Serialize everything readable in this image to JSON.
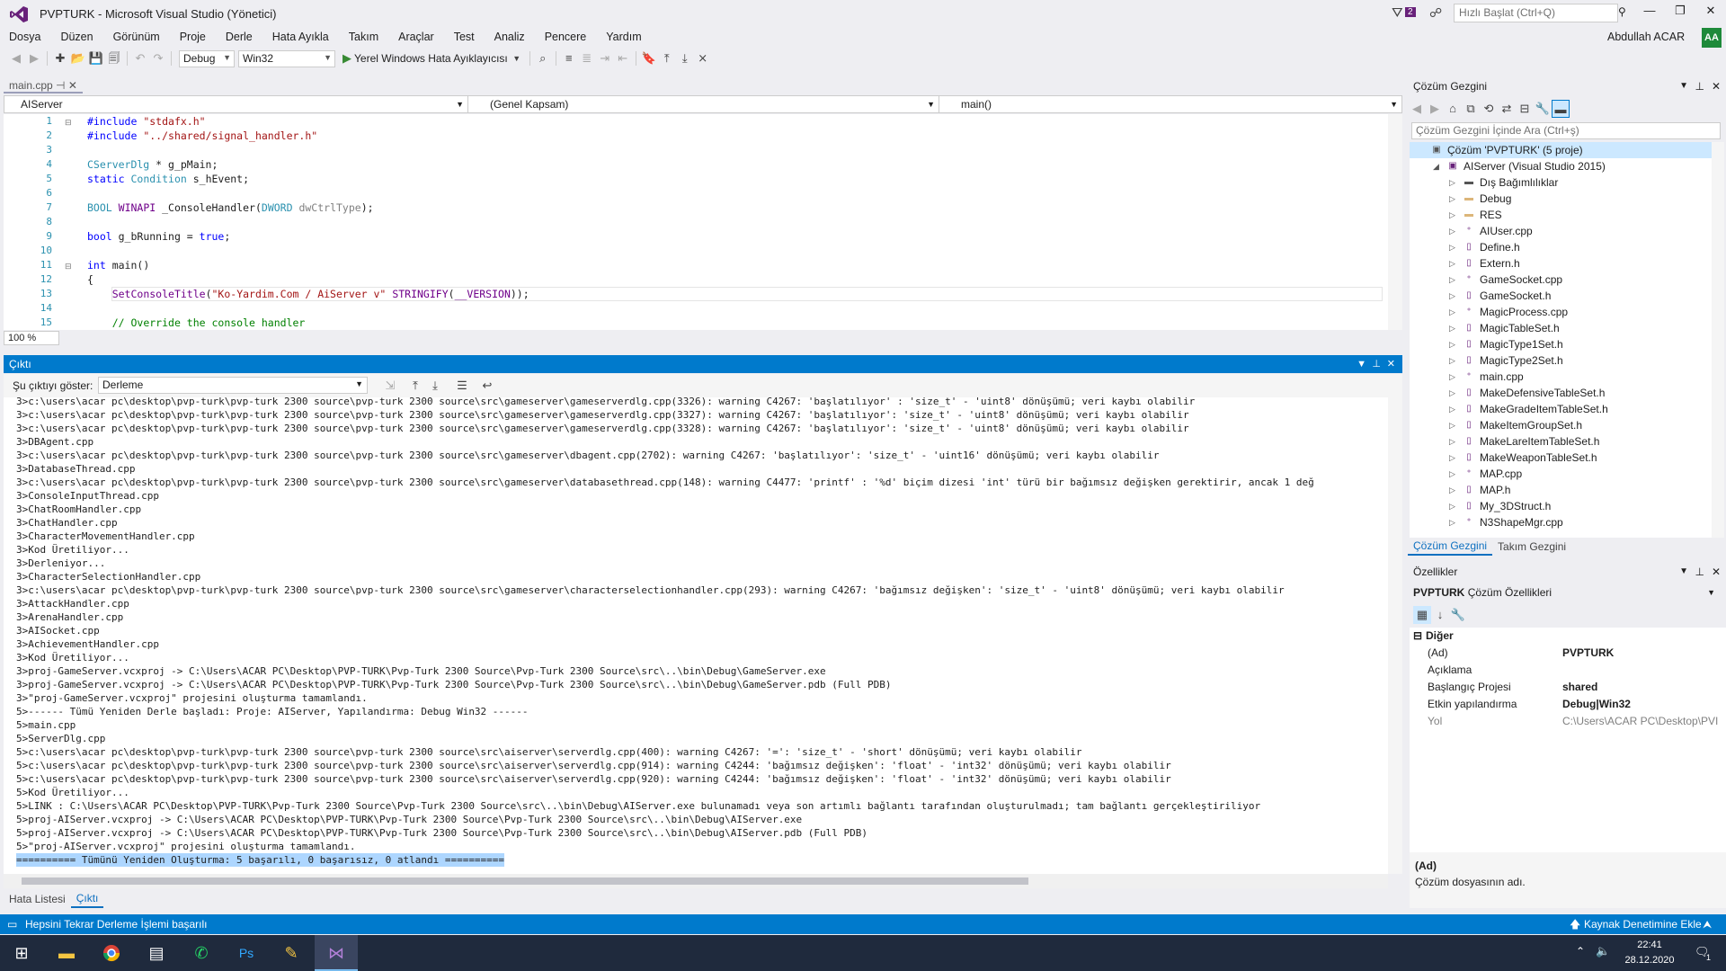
{
  "window": {
    "title": "PVPTURK - Microsoft Visual Studio (Yönetici)",
    "notifications": "2",
    "quick_launch_placeholder": "Hızlı Başlat (Ctrl+Q)",
    "user": "Abdullah ACAR",
    "user_initials": "AA"
  },
  "menu": [
    "Dosya",
    "Düzen",
    "Görünüm",
    "Proje",
    "Derle",
    "Hata Ayıkla",
    "Takım",
    "Araçlar",
    "Test",
    "Analiz",
    "Pencere",
    "Yardım"
  ],
  "toolbar": {
    "configuration": "Debug",
    "platform": "Win32",
    "run_label": "Yerel Windows Hata Ayıklayıcısı"
  },
  "editor": {
    "tab": "main.cpp",
    "nav_project": "AIServer",
    "nav_scope": "(Genel Kapsam)",
    "nav_member": "main()",
    "zoom": "100 %",
    "line_numbers": [
      "1",
      "2",
      "3",
      "4",
      "5",
      "6",
      "7",
      "8",
      "9",
      "10",
      "11",
      "12",
      "13",
      "14",
      "15"
    ]
  },
  "output": {
    "title": "Çıktı",
    "show_label": "Şu çıktıyı göster:",
    "source": "Derleme",
    "lines": [
      "3>c:\\users\\acar pc\\desktop\\pvp-turk\\pvp-turk 2300 source\\pvp-turk 2300 source\\src\\gameserver\\gameserverdlg.cpp(3326): warning C4267: 'başlatılıyor' : 'size_t' - 'uint8' dönüşümü; veri kaybı olabilir",
      "3>c:\\users\\acar pc\\desktop\\pvp-turk\\pvp-turk 2300 source\\pvp-turk 2300 source\\src\\gameserver\\gameserverdlg.cpp(3327): warning C4267: 'başlatılıyor': 'size_t' - 'uint8' dönüşümü; veri kaybı olabilir",
      "3>c:\\users\\acar pc\\desktop\\pvp-turk\\pvp-turk 2300 source\\pvp-turk 2300 source\\src\\gameserver\\gameserverdlg.cpp(3328): warning C4267: 'başlatılıyor': 'size_t' - 'uint8' dönüşümü; veri kaybı olabilir",
      "3>DBAgent.cpp",
      "3>c:\\users\\acar pc\\desktop\\pvp-turk\\pvp-turk 2300 source\\pvp-turk 2300 source\\src\\gameserver\\dbagent.cpp(2702): warning C4267: 'başlatılıyor': 'size_t' - 'uint16' dönüşümü; veri kaybı olabilir",
      "3>DatabaseThread.cpp",
      "3>c:\\users\\acar pc\\desktop\\pvp-turk\\pvp-turk 2300 source\\pvp-turk 2300 source\\src\\gameserver\\databasethread.cpp(148): warning C4477: 'printf' : '%d' biçim dizesi 'int' türü bir bağımsız değişken gerektirir, ancak 1 değ",
      "3>ConsoleInputThread.cpp",
      "3>ChatRoomHandler.cpp",
      "3>ChatHandler.cpp",
      "3>CharacterMovementHandler.cpp",
      "3>Kod Üretiliyor...",
      "3>Derleniyor...",
      "3>CharacterSelectionHandler.cpp",
      "3>c:\\users\\acar pc\\desktop\\pvp-turk\\pvp-turk 2300 source\\pvp-turk 2300 source\\src\\gameserver\\characterselectionhandler.cpp(293): warning C4267: 'bağımsız değişken': 'size_t' - 'uint8' dönüşümü; veri kaybı olabilir",
      "3>AttackHandler.cpp",
      "3>ArenaHandler.cpp",
      "3>AISocket.cpp",
      "3>AchievementHandler.cpp",
      "3>Kod Üretiliyor...",
      "3>proj-GameServer.vcxproj -> C:\\Users\\ACAR PC\\Desktop\\PVP-TURK\\Pvp-Turk 2300 Source\\Pvp-Turk 2300 Source\\src\\..\\bin\\Debug\\GameServer.exe",
      "3>proj-GameServer.vcxproj -> C:\\Users\\ACAR PC\\Desktop\\PVP-TURK\\Pvp-Turk 2300 Source\\Pvp-Turk 2300 Source\\src\\..\\bin\\Debug\\GameServer.pdb (Full PDB)",
      "3>\"proj-GameServer.vcxproj\" projesini oluşturma tamamlandı.",
      "5>------ Tümü Yeniden Derle başladı: Proje: AIServer, Yapılandırma: Debug Win32 ------",
      "5>main.cpp",
      "5>ServerDlg.cpp",
      "5>c:\\users\\acar pc\\desktop\\pvp-turk\\pvp-turk 2300 source\\pvp-turk 2300 source\\src\\aiserver\\serverdlg.cpp(400): warning C4267: '=': 'size_t' - 'short' dönüşümü; veri kaybı olabilir",
      "5>c:\\users\\acar pc\\desktop\\pvp-turk\\pvp-turk 2300 source\\pvp-turk 2300 source\\src\\aiserver\\serverdlg.cpp(914): warning C4244: 'bağımsız değişken': 'float' - 'int32' dönüşümü; veri kaybı olabilir",
      "5>c:\\users\\acar pc\\desktop\\pvp-turk\\pvp-turk 2300 source\\pvp-turk 2300 source\\src\\aiserver\\serverdlg.cpp(920): warning C4244: 'bağımsız değişken': 'float' - 'int32' dönüşümü; veri kaybı olabilir",
      "5>Kod Üretiliyor...",
      "5>LINK : C:\\Users\\ACAR PC\\Desktop\\PVP-TURK\\Pvp-Turk 2300 Source\\Pvp-Turk 2300 Source\\src\\..\\bin\\Debug\\AIServer.exe bulunamadı veya son artımlı bağlantı tarafından oluşturulmadı; tam bağlantı gerçekleştiriliyor",
      "5>proj-AIServer.vcxproj -> C:\\Users\\ACAR PC\\Desktop\\PVP-TURK\\Pvp-Turk 2300 Source\\Pvp-Turk 2300 Source\\src\\..\\bin\\Debug\\AIServer.exe",
      "5>proj-AIServer.vcxproj -> C:\\Users\\ACAR PC\\Desktop\\PVP-TURK\\Pvp-Turk 2300 Source\\Pvp-Turk 2300 Source\\src\\..\\bin\\Debug\\AIServer.pdb (Full PDB)",
      "5>\"proj-AIServer.vcxproj\" projesini oluşturma tamamlandı."
    ],
    "summary": "========== Tümünü Yeniden Oluşturma: 5 başarılı, 0 başarısız, 0 atlandı =========="
  },
  "bottom_tabs": [
    "Hata Listesi",
    "Çıktı"
  ],
  "solution_explorer": {
    "title": "Çözüm Gezgini",
    "search_placeholder": "Çözüm Gezgini İçinde Ara (Ctrl+ş)",
    "solution": "Çözüm 'PVPTURK' (5 proje)",
    "project": "AIServer (Visual Studio 2015)",
    "items": [
      "Dış Bağımlılıklar",
      "Debug",
      "RES",
      "AIUser.cpp",
      "Define.h",
      "Extern.h",
      "GameSocket.cpp",
      "GameSocket.h",
      "MagicProcess.cpp",
      "MagicTableSet.h",
      "MagicType1Set.h",
      "MagicType2Set.h",
      "main.cpp",
      "MakeDefensiveTableSet.h",
      "MakeGradeItemTableSet.h",
      "MakeItemGroupSet.h",
      "MakeLareItemTableSet.h",
      "MakeWeaponTableSet.h",
      "MAP.cpp",
      "MAP.h",
      "My_3DStruct.h",
      "N3ShapeMgr.cpp"
    ],
    "tabs": [
      "Çözüm Gezgini",
      "Takım Gezgini"
    ]
  },
  "properties": {
    "title": "Özellikler",
    "object": "PVPTURK",
    "object_type": "Çözüm Özellikleri",
    "category": "Diğer",
    "rows": [
      {
        "key": "(Ad)",
        "value": "PVPTURK"
      },
      {
        "key": "Açıklama",
        "value": ""
      },
      {
        "key": "Başlangıç Projesi",
        "value": "shared"
      },
      {
        "key": "Etkin yapılandırma",
        "value": "Debug|Win32"
      },
      {
        "key": "Yol",
        "value": "C:\\Users\\ACAR PC\\Desktop\\PVI"
      }
    ],
    "desc_title": "(Ad)",
    "desc_text": "Çözüm dosyasının adı."
  },
  "status": {
    "message": "Hepsini Tekrar Derleme İşlemi başarılı",
    "source_control": "Kaynak Denetimine Ekle"
  },
  "taskbar": {
    "time": "22:41",
    "date": "28.12.2020",
    "notification_count": "1"
  },
  "colors": {
    "accent": "#007acc",
    "vs_purple": "#68217a"
  }
}
